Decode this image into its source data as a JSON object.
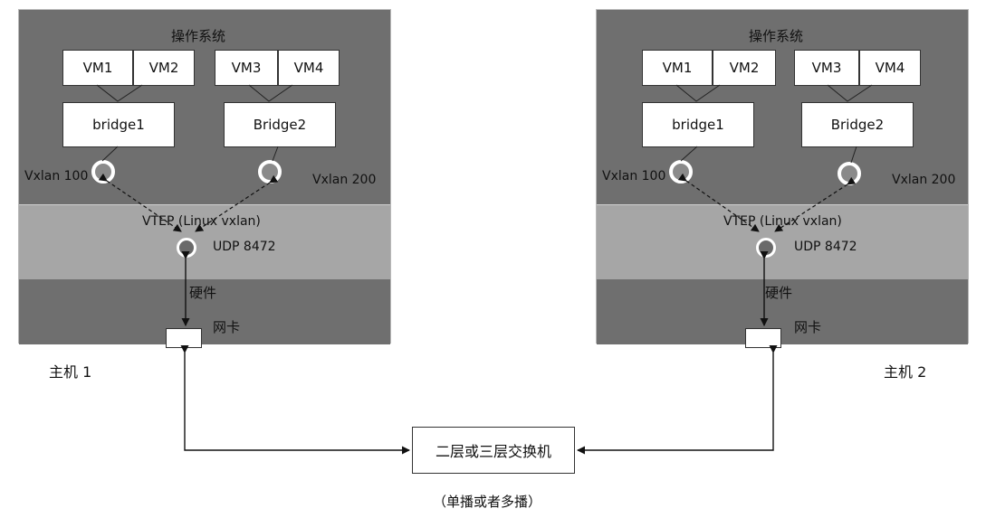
{
  "host1": {
    "os_label": "操作系统",
    "vms": [
      "VM1",
      "VM2",
      "VM3",
      "VM4"
    ],
    "bridges": [
      "bridge1",
      "Bridge2"
    ],
    "vxlan_a": "Vxlan 100",
    "vxlan_b": "Vxlan 200",
    "vtep": "VTEP (Linux vxlan)",
    "udp": "UDP 8472",
    "hardware": "硬件",
    "nic": "网卡",
    "name": "主机 1"
  },
  "host2": {
    "os_label": "操作系统",
    "vms": [
      "VM1",
      "VM2",
      "VM3",
      "VM4"
    ],
    "bridges": [
      "bridge1",
      "Bridge2"
    ],
    "vxlan_a": "Vxlan 100",
    "vxlan_b": "Vxlan 200",
    "vtep": "VTEP (Linux vxlan)",
    "udp": "UDP 8472",
    "hardware": "硬件",
    "nic": "网卡",
    "name": "主机 2"
  },
  "switch": {
    "label": "二层或三层交换机"
  },
  "caption": "（单播或者多播）"
}
